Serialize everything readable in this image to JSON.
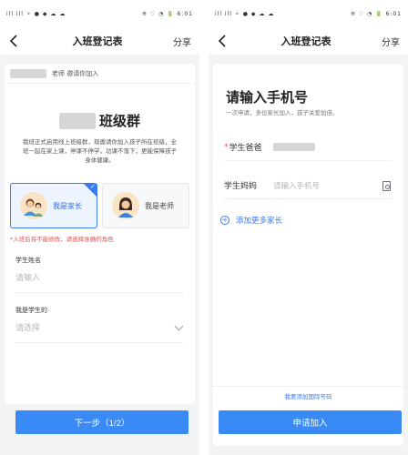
{
  "status_bar": {
    "left_icons": "ill ill ⚬ ● ◆ ☁ ☁",
    "right_icons": "❊ ♡ ◔ 🔋 6:01",
    "time": "6:01"
  },
  "screen1": {
    "nav": {
      "title": "入班登记表",
      "share": "分享"
    },
    "invite_text": "老师 邀请你加入",
    "class_name_suffix": "班级群",
    "description": "我班正式启用线上班级群，现邀请你加入孩子所在班级，全班一起在家上课，停课不停学，功课不落下，更能保障孩子身体健康。",
    "roles": [
      {
        "label": "我是家长",
        "selected": true
      },
      {
        "label": "我是老师",
        "selected": false
      }
    ],
    "warning": "*入班后将不能修改，请选择准确的角色",
    "fields": [
      {
        "label": "学生姓名",
        "placeholder": "请输入"
      },
      {
        "label": "我是学生的",
        "placeholder": "请选择"
      }
    ],
    "next_button": "下一步（1/2）"
  },
  "screen2": {
    "nav": {
      "title": "入班登记表",
      "share": "分享"
    },
    "title": "请输入手机号",
    "subtitle": "一次申请，多位家长加入，孩子关爱加倍。",
    "rows": [
      {
        "required_mark": "*",
        "label": "学生爸爸"
      },
      {
        "label": "学生妈妈",
        "placeholder": "请输入手机号"
      }
    ],
    "add_more": "添加更多家长",
    "intl_link": "我要添加国际号码",
    "apply_button": "申请加入"
  },
  "colors": {
    "accent": "#3a8af5",
    "warning": "#e05555",
    "background": "#f2f3f5"
  }
}
